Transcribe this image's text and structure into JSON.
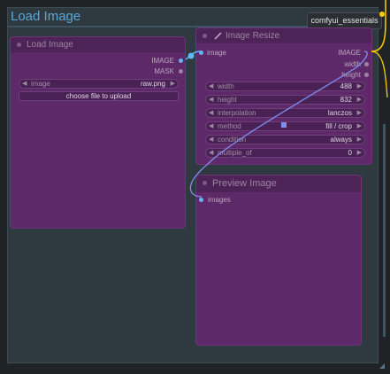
{
  "group": {
    "title": "Load Image",
    "badge": "comfyui_essentials"
  },
  "load_image": {
    "title": "Load Image",
    "outputs": [
      "IMAGE",
      "MASK"
    ],
    "image_widget": {
      "label": "image",
      "value": "raw.png"
    },
    "upload_button": "choose file to upload"
  },
  "image_resize": {
    "title": "Image Resize",
    "input": "image",
    "outputs": [
      "IMAGE",
      "width",
      "height"
    ],
    "widgets": [
      {
        "label": "width",
        "value": "488"
      },
      {
        "label": "height",
        "value": "832"
      },
      {
        "label": "interpolation",
        "value": "lanczos"
      },
      {
        "label": "method",
        "value": "fill / crop"
      },
      {
        "label": "condition",
        "value": "always"
      },
      {
        "label": "multiple_of",
        "value": "0"
      }
    ]
  },
  "preview_image": {
    "title": "Preview Image",
    "input": "images"
  },
  "colors": {
    "node_bg": "#5d2969",
    "link_image": "#64b5f6",
    "link_other": "#ffcc00",
    "title": "#59a7d6"
  }
}
